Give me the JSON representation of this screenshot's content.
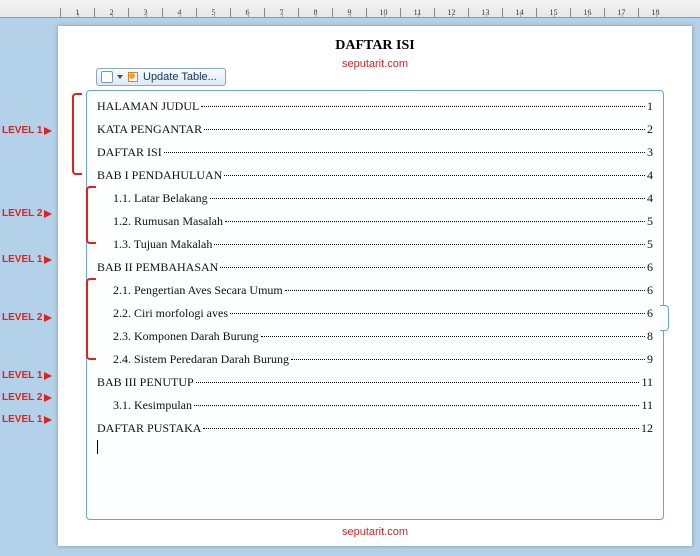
{
  "ruler": {
    "marks": [
      1,
      2,
      3,
      4,
      5,
      6,
      7,
      8,
      9,
      10,
      11,
      12,
      13,
      14,
      15,
      16,
      17,
      18
    ]
  },
  "update_button": {
    "label": "Update Table..."
  },
  "title": "DAFTAR ISI",
  "watermark": "seputarit.com",
  "levels": {
    "l1": "LEVEL 1",
    "l2": "LEVEL 2"
  },
  "toc": [
    {
      "level": 1,
      "label": "HALAMAN JUDUL",
      "page": "1"
    },
    {
      "level": 1,
      "label": "KATA PENGANTAR",
      "page": "2"
    },
    {
      "level": 1,
      "label": "DAFTAR ISI",
      "page": "3"
    },
    {
      "level": 1,
      "label": "BAB I PENDAHULUAN",
      "page": "4"
    },
    {
      "level": 2,
      "label": "1.1.  Latar Belakang",
      "page": "4"
    },
    {
      "level": 2,
      "label": "1.2.  Rumusan  Masalah",
      "page": "5"
    },
    {
      "level": 2,
      "label": "1.3.  Tujuan Makalah",
      "page": "5"
    },
    {
      "level": 1,
      "label": "BAB II PEMBAHASAN",
      "page": "6"
    },
    {
      "level": 2,
      "label": "2.1.  Pengertian Aves Secara Umum",
      "page": "6"
    },
    {
      "level": 2,
      "label": "2.2.  Ciri morfologi aves",
      "page": "6"
    },
    {
      "level": 2,
      "label": "2.3.  Komponen Darah Burung",
      "page": "8"
    },
    {
      "level": 2,
      "label": "2.4.  Sistem Peredaran Darah Burung",
      "page": "9"
    },
    {
      "level": 1,
      "label": "BAB III PENUTUP",
      "page": "11"
    },
    {
      "level": 2,
      "label": "3.1.  Kesimpulan",
      "page": "11"
    },
    {
      "level": 1,
      "label": "DAFTAR PUSTAKA",
      "page": "12"
    }
  ]
}
